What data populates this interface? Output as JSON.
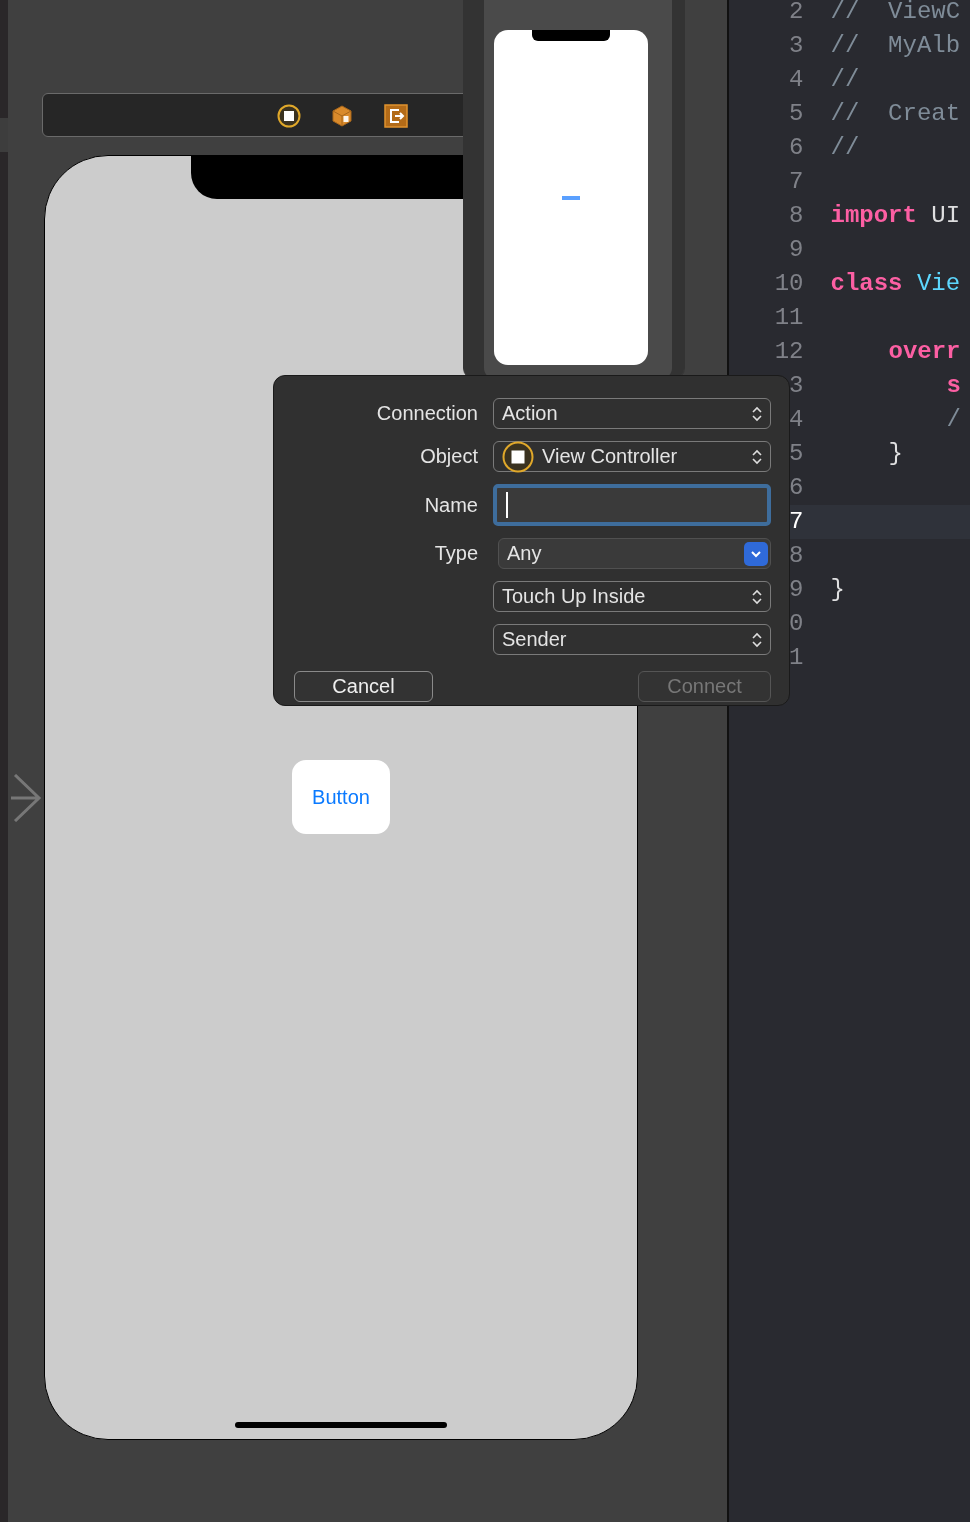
{
  "scene": {
    "button_label": "Button"
  },
  "dialog": {
    "fields": [
      {
        "label": "Connection",
        "kind": "popup",
        "value": "Action"
      },
      {
        "label": "Object",
        "kind": "object",
        "value": "View Controller"
      },
      {
        "label": "Name",
        "kind": "text",
        "focused": true
      },
      {
        "label": "Type",
        "kind": "combo",
        "value": "Any"
      },
      {
        "kind": "popup",
        "value": "Touch Up Inside"
      },
      {
        "kind": "popup",
        "value": "Sender"
      }
    ],
    "buttons": [
      {
        "label": "Cancel",
        "disabled": false
      },
      {
        "label": "Connect",
        "disabled": true
      }
    ]
  },
  "editor": {
    "lines": [
      {
        "number": "2",
        "kind": "top",
        "current": false,
        "tokens": [
          {
            "kind": "comment",
            "text": "//  ViewC"
          }
        ]
      },
      {
        "number": "3",
        "kind": "top",
        "current": false,
        "tokens": [
          {
            "kind": "comment",
            "text": "//  MyAlb"
          }
        ]
      },
      {
        "number": "4",
        "kind": "top",
        "current": false,
        "tokens": [
          {
            "kind": "comment",
            "text": "//"
          }
        ]
      },
      {
        "number": "5",
        "kind": "top",
        "current": false,
        "tokens": [
          {
            "kind": "comment",
            "text": "//  Creat"
          }
        ]
      },
      {
        "number": "6",
        "kind": "top",
        "current": false,
        "tokens": [
          {
            "kind": "comment",
            "text": "//"
          }
        ]
      },
      {
        "number": "7",
        "current": false
      },
      {
        "number": "8",
        "kind": "top",
        "current": false,
        "tokens": [
          {
            "kind": "keyword",
            "text": "import"
          },
          {
            "kind": "plain",
            "text": " UI"
          }
        ]
      },
      {
        "number": "9",
        "current": false
      },
      {
        "number": "10",
        "kind": "top",
        "current": false,
        "tokens": [
          {
            "kind": "keyword",
            "text": "class"
          },
          {
            "kind": "type",
            "text": " Vie"
          }
        ]
      },
      {
        "number": "11",
        "current": false
      },
      {
        "number": "12",
        "kind": "member",
        "current": false,
        "tokens": [
          {
            "kind": "keyword",
            "text": "overr"
          }
        ]
      },
      {
        "number": "3",
        "kind": "body",
        "current": false,
        "tokens": [
          {
            "kind": "keyword",
            "text": "s"
          }
        ]
      },
      {
        "number": "4",
        "kind": "body",
        "current": false,
        "tokens": [
          {
            "kind": "comment",
            "text": "/"
          }
        ]
      },
      {
        "number": "5",
        "kind": "member",
        "current": false,
        "tokens": [
          {
            "kind": "plain",
            "text": "}"
          }
        ]
      },
      {
        "number": "6",
        "current": false
      },
      {
        "number": "7",
        "current": true
      },
      {
        "number": "8",
        "current": false
      },
      {
        "number": "9",
        "kind": "top",
        "current": false,
        "tokens": [
          {
            "kind": "plain",
            "text": "}"
          }
        ]
      },
      {
        "number": "0",
        "current": false
      },
      {
        "number": "1",
        "current": false
      }
    ]
  }
}
